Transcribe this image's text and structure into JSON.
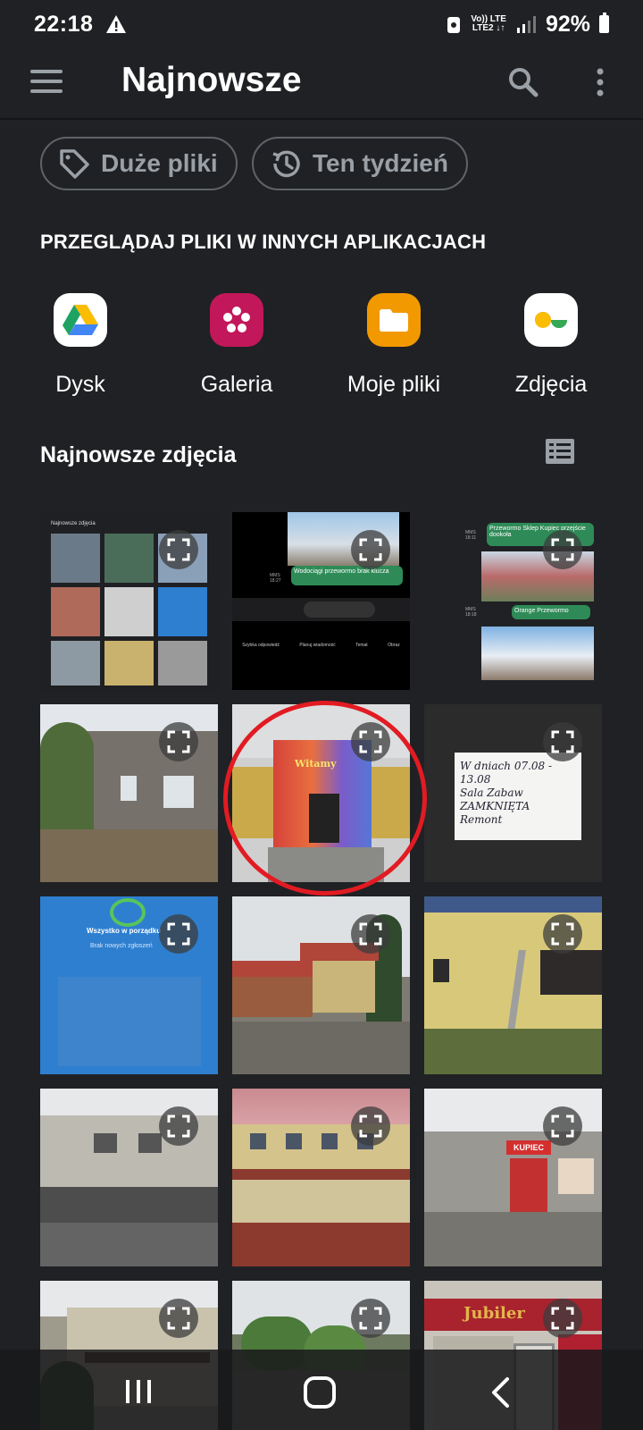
{
  "status_bar": {
    "time": "22:18",
    "network_top": "Vo)) LTE",
    "network_bottom": "LTE2 ↓↑",
    "battery": "92%"
  },
  "app_bar": {
    "title": "Najnowsze",
    "icons": [
      "menu-icon",
      "search-icon",
      "more-vert-icon"
    ]
  },
  "chips": [
    {
      "label": "Duże pliki",
      "icon": "tag-icon"
    },
    {
      "label": "Ten tydzień",
      "icon": "history-icon"
    }
  ],
  "browse_section": {
    "heading": "PRZEGLĄDAJ PLIKI W INNYCH APLIKACJACH",
    "apps": [
      {
        "label": "Dysk",
        "icon": "google-drive-icon"
      },
      {
        "label": "Galeria",
        "icon": "gallery-icon",
        "color": "#c2185b"
      },
      {
        "label": "Moje pliki",
        "icon": "my-files-icon",
        "color": "#f29900"
      },
      {
        "label": "Zdjęcia",
        "icon": "google-photos-icon"
      }
    ]
  },
  "recent_photos": {
    "heading": "Najnowsze zdjęcia",
    "view_toggle_icon": "list-view-icon",
    "tiles": [
      {
        "id": 1,
        "kind": "screenshot"
      },
      {
        "id": 2,
        "kind": "screenshot"
      },
      {
        "id": 3,
        "kind": "screenshot"
      },
      {
        "id": 4,
        "kind": "photo"
      },
      {
        "id": 5,
        "kind": "photo",
        "highlighted": true
      },
      {
        "id": 6,
        "kind": "photo"
      },
      {
        "id": 7,
        "kind": "screenshot"
      },
      {
        "id": 8,
        "kind": "photo"
      },
      {
        "id": 9,
        "kind": "photo"
      },
      {
        "id": 10,
        "kind": "photo"
      },
      {
        "id": 11,
        "kind": "photo"
      },
      {
        "id": 12,
        "kind": "photo"
      },
      {
        "id": 13,
        "kind": "photo"
      },
      {
        "id": 14,
        "kind": "photo"
      },
      {
        "id": 15,
        "kind": "photo"
      }
    ],
    "tile_texts": {
      "t1_title": "Najnowsze zdjęcia",
      "t2_msg": "Wodociągi przewormo brak klucza",
      "t2_meta": "MMS 18:27",
      "t2_actions": [
        "Szybka odpowiedź",
        "Planuj wiadomość",
        "Temat",
        "Obraz"
      ],
      "t3_msg1": "Przewormo Sklep Kupiec przejście dookoła",
      "t3_msg2": "Orange Przewormo",
      "t3_meta1": "MMS 18:11",
      "t3_meta2": "MMS 18:18",
      "t5_sign": "Witamy",
      "t6_note": [
        "W dniach 07.08 - 13.08",
        "Sala Zabaw",
        "ZAMKNIĘTA",
        "Remont"
      ],
      "t7_title": "Wszystko w porządku",
      "t7_sub": "Brak nowych zgłoszeń",
      "t12_sign": "KUPIEC",
      "t15_sign": "Jubiler"
    }
  },
  "nav_bar": {
    "buttons": [
      "recent-apps",
      "home",
      "back"
    ]
  }
}
